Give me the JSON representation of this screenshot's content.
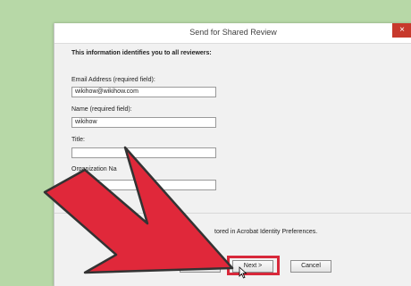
{
  "dialog": {
    "title": "Send for Shared Review",
    "close_glyph": "×",
    "intro": "This information identifies you to all reviewers:",
    "fields": [
      {
        "label": "Email Address (required field):",
        "value": "wikihow@wikihow.com"
      },
      {
        "label": "Name (required field):",
        "value": "wikihow"
      },
      {
        "label": "Title:",
        "value": ""
      },
      {
        "label": "Organization Na",
        "value": ""
      }
    ],
    "note": "tored in Acrobat Identity Preferences.",
    "buttons": {
      "back": "< Previous",
      "next": "Next >",
      "cancel": "Cancel"
    }
  },
  "annotations": {
    "highlight_color": "#d8283a",
    "arrow_color": "#e0283a"
  }
}
